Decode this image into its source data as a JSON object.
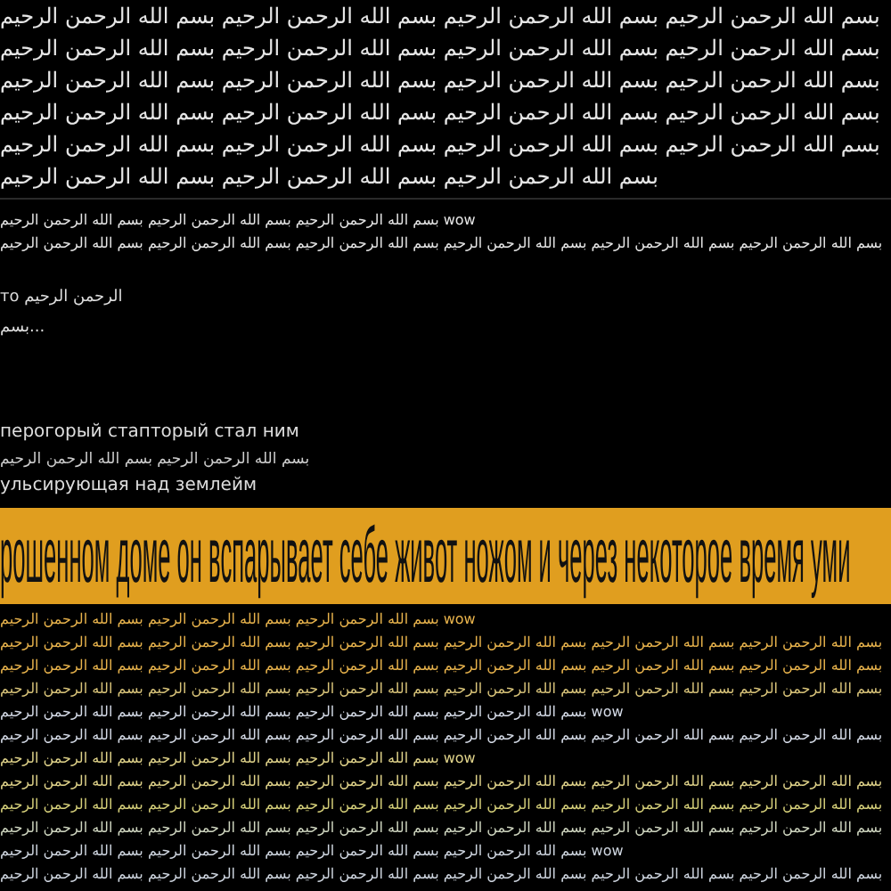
{
  "header_rows": [
    "بسم الله الرحمن الرحيم بسم الله الرحمن الرحيم بسم الله الرحمن الرحيم بسم الله الرحمن الرحيم",
    "بسم الله الرحمن الرحيم بسم الله الرحمن الرحيم بسم الله الرحمن الرحيم بسم الله الرحمن الرحيم",
    "بسم الله الرحمن الرحيم بسم الله الرحمن الرحيم بسم الله الرحمن الرحيم بسم الله الرحمن الرحيم",
    "بسم الله الرحمن الرحيم بسم الله الرحمن الرحيم بسم الله الرحمن الرحيم بسم الله الرحمن الرحيم",
    "بسم الله الرحمن الرحيم بسم الله الرحمن الرحيم بسم الله الرحمن الرحيم بسم الله الرحمن الرحيم",
    "بسم الله الرحمن الرحيم بسم الله الرحمن الرحيم بسم الله الرحمن الرحيم"
  ],
  "top_feed": [
    {
      "text": "بسم الله الرحمن الرحيم بسم الله الرحمن الرحيم بسم الله الرحمن الرحيم wow",
      "color": "#e6e6e6"
    },
    {
      "text": "بسم الله الرحمن الرحيم بسم الله الرحمن الرحيم بسم الله الرحمن الرحيم بسم الله الرحمن الرحيم بسم الله الرحمن الرحيم بسم الله الرحمن الرحيم",
      "color": "#e6e6e6"
    }
  ],
  "snippets": [
    "то الرحمن الرحيم",
    "بسم..."
  ],
  "post": [
    {
      "kind": "text",
      "text": "перогорый стапторый стал ним"
    },
    {
      "kind": "arabic",
      "text": "بسم الله الرحمن الرحيم بسم الله الرحمن الرحيم"
    },
    {
      "kind": "text",
      "text": "ульсирующая над землейм"
    }
  ],
  "banner": "рошенном доме он вспарывает себе живот ножом и через некоторое время уми",
  "bottom_feed": [
    {
      "text": "بسم الله الرحمن الرحيم بسم الله الرحمن الرحيم بسم الله الرحمن الرحيم wow",
      "color": "#e8b34c"
    },
    {
      "text": "بسم الله الرحمن الرحيم بسم الله الرحمن الرحيم بسم الله الرحمن الرحيم بسم الله الرحمن الرحيم بسم الله الرحمن الرحيم بسم الله الرحمن الرحيم",
      "color": "#e8b34c"
    },
    {
      "text": "بسم الله الرحمن الرحيم بسم الله الرحمن الرحيم بسم الله الرحمن الرحيم بسم الله الرحمن الرحيم بسم الله الرحمن الرحيم بسم الله الرحمن الرحيم",
      "color": "#e8b34c"
    },
    {
      "text": "بسم الله الرحمن الرحيم بسم الله الرحمن الرحيم بسم الله الرحمن الرحيم بسم الله الرحمن الرحيم بسم الله الرحمن الرحيم بسم الله الرحمن الرحيم",
      "color": "#d9c47a"
    },
    {
      "text": "بسم الله الرحمن الرحيم بسم الله الرحمن الرحيم بسم الله الرحمن الرحيم بسم الله الرحمن الرحيم wow",
      "color": "#d4dae6"
    },
    {
      "text": "بسم الله الرحمن الرحيم بسم الله الرحمن الرحيم بسم الله الرحمن الرحيم بسم الله الرحمن الرحيم بسم الله الرحمن الرحيم بسم الله الرحمن الرحيم",
      "color": "#d4dae6"
    },
    {
      "text": "بسم الله الرحمن الرحيم بسم الله الرحمن الرحيم بسم الله الرحمن الرحيم wow",
      "color": "#e0d38a"
    },
    {
      "text": "بسم الله الرحمن الرحيم بسم الله الرحمن الرحيم بسم الله الرحمن الرحيم بسم الله الرحمن الرحيم بسم الله الرحمن الرحيم بسم الله الرحمن الرحيم",
      "color": "#e0d38a"
    },
    {
      "text": "بسم الله الرحمن الرحيم بسم الله الرحمن الرحيم بسم الله الرحمن الرحيم بسم الله الرحمن الرحيم بسم الله الرحمن الرحيم بسم الله الرحمن الرحيم",
      "color": "#d6d07a"
    },
    {
      "text": "بسم الله الرحمن الرحيم بسم الله الرحمن الرحيم بسم الله الرحمن الرحيم بسم الله الرحمن الرحيم بسم الله الرحمن الرحيم بسم الله الرحمن الرحيم",
      "color": "#cfd6c0"
    },
    {
      "text": "بسم الله الرحمن الرحيم بسم الله الرحمن الرحيم بسم الله الرحمن الرحيم بسم الله الرحمن الرحيم wow",
      "color": "#cfd6e0"
    },
    {
      "text": "بسم الله الرحمن الرحيم بسم الله الرحمن الرحيم بسم الله الرحمن الرحيم بسم الله الرحمن الرحيم بسم الله الرحمن الرحيم بسم الله الرحمن الرحيم",
      "color": "#cfd6e0"
    }
  ]
}
